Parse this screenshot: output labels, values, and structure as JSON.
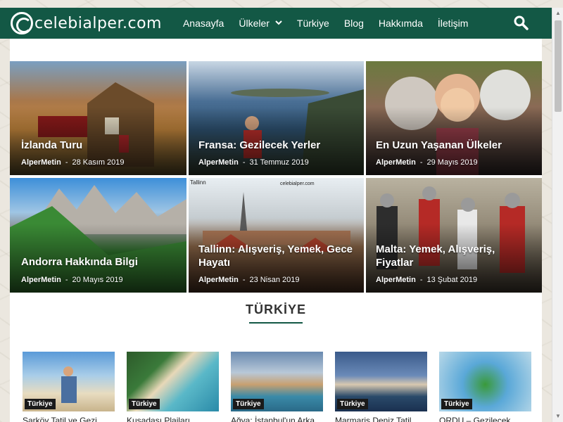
{
  "logo": {
    "text": "celebialper.com"
  },
  "nav": {
    "items": [
      {
        "label": "Anasayfa"
      },
      {
        "label": "Ülkeler",
        "dropdown": true
      },
      {
        "label": "Türkiye"
      },
      {
        "label": "Blog"
      },
      {
        "label": "Hakkımda"
      },
      {
        "label": "İletişim"
      }
    ]
  },
  "featured": [
    {
      "title": "İzlanda Turu",
      "author": "AlperMetin",
      "date": "28 Kasım 2019"
    },
    {
      "title": "Fransa: Gezilecek Yerler",
      "author": "AlperMetin",
      "date": "31 Temmuz 2019"
    },
    {
      "title": "En Uzun Yaşanan Ülkeler",
      "author": "AlperMetin",
      "date": "29 Mayıs 2019"
    },
    {
      "title": "Andorra Hakkında Bilgi",
      "author": "AlperMetin",
      "date": "20 Mayıs 2019"
    },
    {
      "title": "Tallinn: Alışveriş, Yemek, Gece Hayatı",
      "author": "AlperMetin",
      "date": "23 Nisan 2019",
      "img_caption_left": "Tallinn",
      "img_caption_right": "celebialper.com"
    },
    {
      "title": "Malta: Yemek, Alışveriş, Fiyatlar",
      "author": "AlperMetin",
      "date": "13 Şubat 2019"
    }
  ],
  "section": {
    "title": "TÜRKİYE"
  },
  "cards": [
    {
      "badge": "Türkiye",
      "title": "Şarköy Tatil ve Gezi"
    },
    {
      "badge": "Türkiye",
      "title": "Kuşadası Plajları"
    },
    {
      "badge": "Türkiye",
      "title": "Ağva: İstanbul'un Arka"
    },
    {
      "badge": "Türkiye",
      "title": "Marmaris Deniz Tatil"
    },
    {
      "badge": "Türkiye",
      "title": "ORDU – Gezilecek"
    }
  ],
  "colors": {
    "header": "#135845",
    "accent": "#135845"
  },
  "icons": {
    "search": "search-icon",
    "dropdown": "chevron-down-icon"
  }
}
